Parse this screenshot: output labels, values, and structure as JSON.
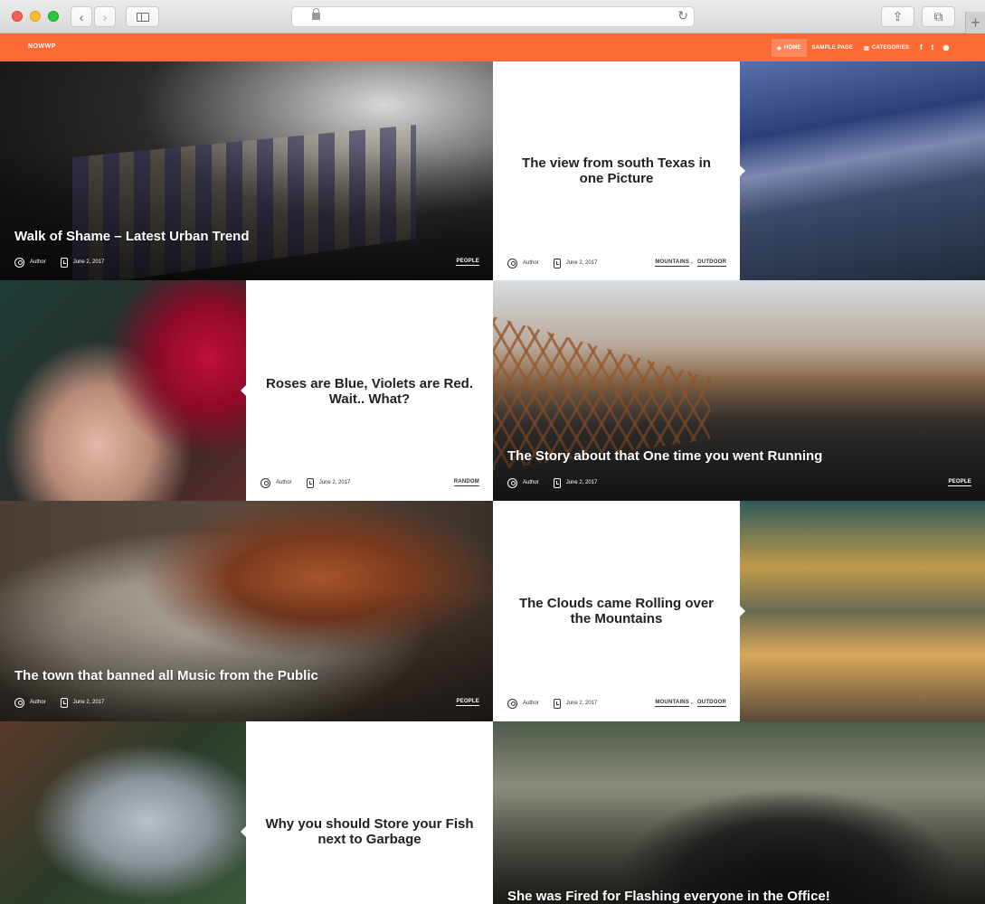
{
  "browser": {
    "back_icon": "‹",
    "forward_icon": "›",
    "reload_icon": "↻",
    "share_icon": "⇪",
    "tabs_icon": "⧉",
    "new_tab_icon": "+"
  },
  "nav": {
    "brand": "NOWWP",
    "menu": [
      {
        "label": "HOME",
        "icon": "◈",
        "active": true
      },
      {
        "label": "SAMPLE PAGE",
        "icon": "",
        "active": false
      },
      {
        "label": "CATEGORIES",
        "icon": "▤",
        "active": false
      }
    ],
    "social": [
      {
        "name": "facebook",
        "glyph": "f"
      },
      {
        "name": "twitter",
        "glyph": "t"
      },
      {
        "name": "github",
        "glyph": "◉"
      }
    ],
    "accent_color": "#fd6b35"
  },
  "posts": [
    {
      "title": "Walk of Shame – Latest Urban Trend",
      "author": "Author",
      "date": "June 2, 2017",
      "categories": [
        "PEOPLE"
      ]
    },
    {
      "title": "The view from south Texas in one Picture",
      "author": "Author",
      "date": "June 2, 2017",
      "categories": [
        "MOUNTAINS",
        "OUTDOOR"
      ]
    },
    {
      "title": "Roses are Blue, Violets are Red. Wait.. What?",
      "author": "Author",
      "date": "June 2, 2017",
      "categories": [
        "RANDOM"
      ]
    },
    {
      "title": "The Story about that One time you went Running",
      "author": "Author",
      "date": "June 2, 2017",
      "categories": [
        "PEOPLE"
      ]
    },
    {
      "title": "The town that banned all Music from the Public",
      "author": "Author",
      "date": "June 2, 2017",
      "categories": [
        "PEOPLE"
      ]
    },
    {
      "title": "The Clouds came Rolling over the Mountains",
      "author": "Author",
      "date": "June 2, 2017",
      "categories": [
        "MOUNTAINS",
        "OUTDOOR"
      ]
    },
    {
      "title": "Why you should Store your Fish next to Garbage"
    },
    {
      "title": "She was Fired for Flashing everyone in the Office!"
    }
  ],
  "separator": ","
}
